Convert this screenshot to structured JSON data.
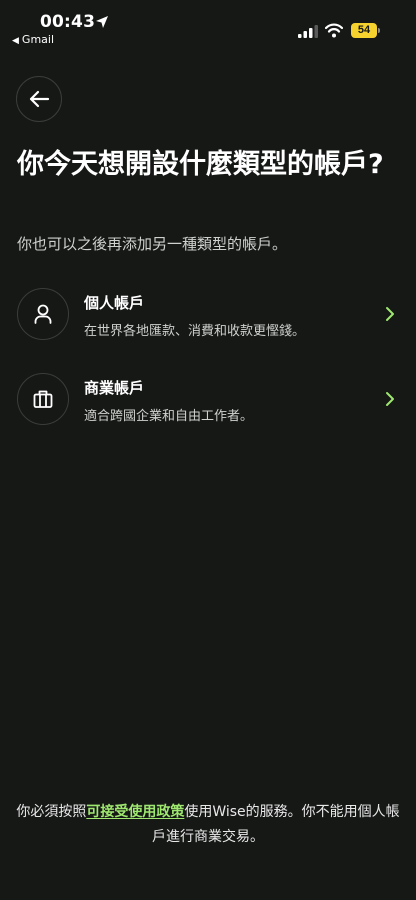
{
  "status_bar": {
    "time": "00:43",
    "back_app": "Gmail",
    "battery": "54",
    "icons": [
      "location-arrow-icon",
      "signal-icon",
      "wifi-icon",
      "battery-icon"
    ]
  },
  "header": {
    "back_icon": "arrow-left-icon"
  },
  "main": {
    "title": "你今天想開設什麼類型的帳戶?",
    "subtitle": "你也可以之後再添加另一種類型的帳戶。",
    "options": [
      {
        "icon": "person-icon",
        "title": "個人帳戶",
        "description": "在世界各地匯款、消費和收款更慳錢。"
      },
      {
        "icon": "briefcase-icon",
        "title": "商業帳戶",
        "description": "適合跨國企業和自由工作者。"
      }
    ]
  },
  "footer": {
    "text_before": "你必須按照",
    "link_text": "可接受使用政策",
    "text_after": "使用Wise的服務。你不能用個人帳戶進行商業交易。"
  },
  "colors": {
    "background": "#161816",
    "accent": "#9fe870",
    "battery": "#f5d22e"
  }
}
